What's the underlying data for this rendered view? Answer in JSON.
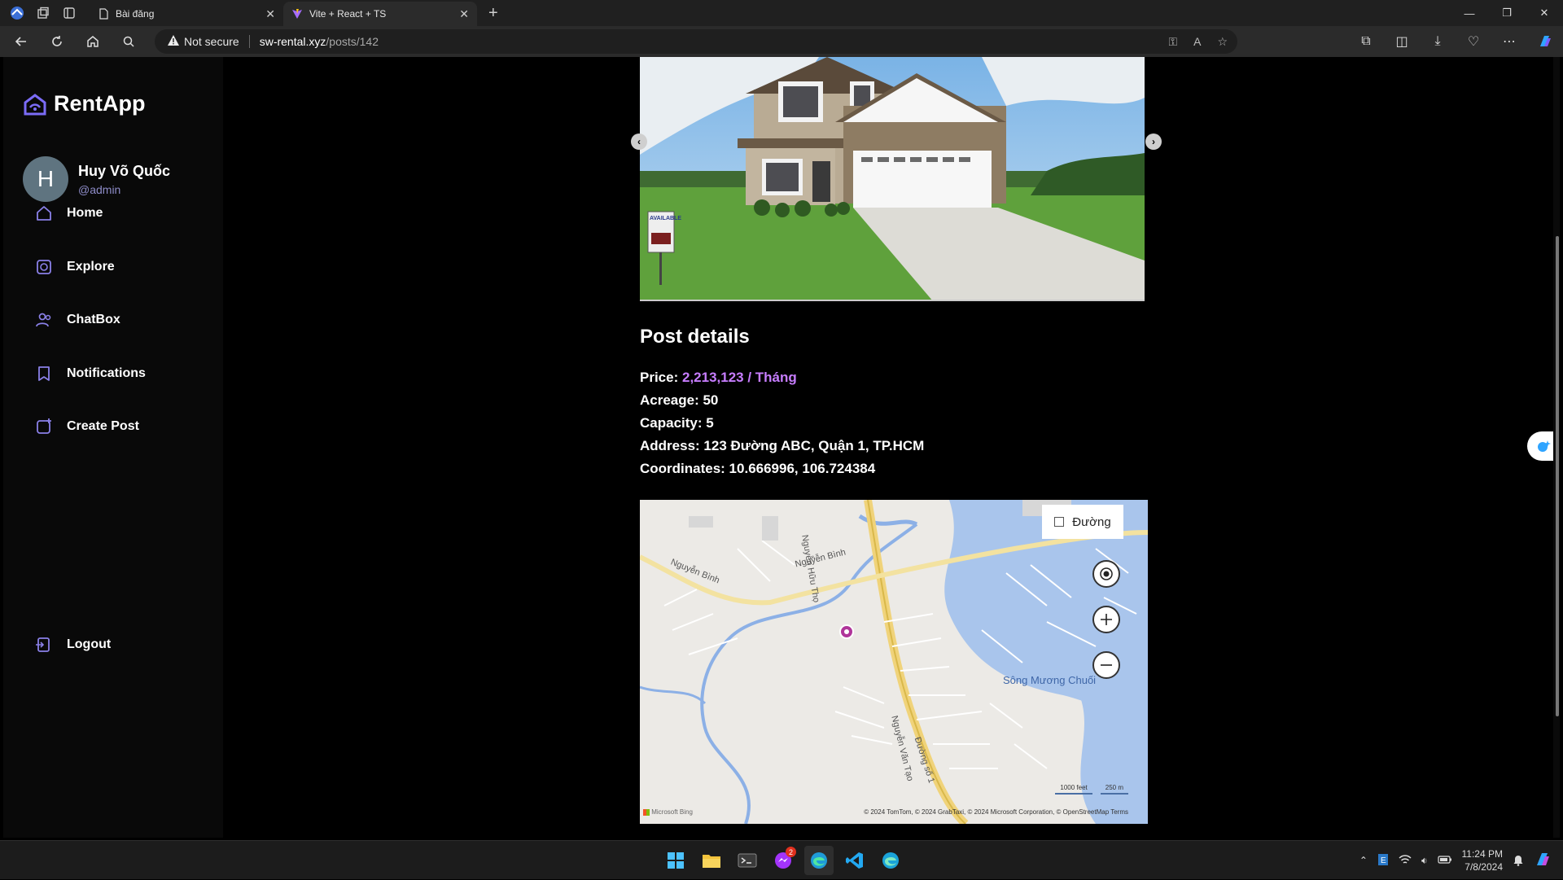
{
  "browser": {
    "tabs": [
      {
        "label": "Bài đăng",
        "active": false
      },
      {
        "label": "Vite + React + TS",
        "active": true
      }
    ],
    "address": {
      "security_label": "Not secure",
      "host": "sw-rental.xyz",
      "path": "/posts/142"
    }
  },
  "sidebar": {
    "logo": "RentApp",
    "profile": {
      "initial": "H",
      "name": "Huy Võ Quốc",
      "handle": "@admin"
    },
    "items": [
      {
        "label": "Home",
        "icon": "home-icon"
      },
      {
        "label": "Explore",
        "icon": "explore-icon"
      },
      {
        "label": "ChatBox",
        "icon": "users-icon"
      },
      {
        "label": "Notifications",
        "icon": "bookmark-icon"
      },
      {
        "label": "Create Post",
        "icon": "create-post-icon"
      }
    ],
    "logout": "Logout"
  },
  "post": {
    "title": "Post details",
    "price_label": "Price:",
    "price_value": "2,213,123 / Tháng",
    "acreage": "Acreage: 50",
    "capacity": "Capacity: 5",
    "address": "Address: 123 Đường ABC, Quận 1, TP.HCM",
    "coordinates": "Coordinates: 10.666996, 106.724384",
    "image_sign": "AVAILABLE"
  },
  "map": {
    "layer_label": "Đường",
    "roads": [
      "Nguyễn Bình",
      "Nguyễn Bình",
      "Nguyễn Hữu Thọ",
      "Nguyễn Văn Tạo",
      "Đường số 1"
    ],
    "river": "Sông Mương Chuối",
    "scale_feet": "1000 feet",
    "scale_m": "250 m",
    "attribution": "© 2024 TomTom, © 2024 GrabTaxi, © 2024 Microsoft Corporation, © OpenStreetMap   Terms",
    "brand": "Microsoft Bing",
    "marker_color": "#b0359a"
  },
  "taskbar": {
    "messenger_badge": "2",
    "time": "11:24 PM",
    "date": "7/8/2024"
  },
  "colors": {
    "accent": "#c77dff",
    "logo": "#7b6cf6",
    "nav_icon": "#8a80e8"
  }
}
